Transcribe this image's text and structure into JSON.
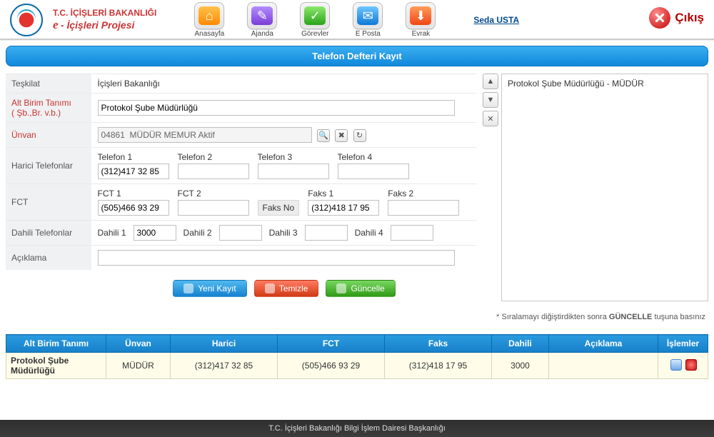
{
  "header": {
    "ministry": "T.C. İÇİŞLERİ BAKANLIĞI",
    "project_prefix": "e",
    "project_rest": " - İçişleri Projesi",
    "nav": [
      {
        "id": "anasayfa",
        "label": "Anasayfa",
        "tint": "orange",
        "glyph": "⌂"
      },
      {
        "id": "ajanda",
        "label": "Ajanda",
        "tint": "purple",
        "glyph": "✎"
      },
      {
        "id": "gorevler",
        "label": "Görevler",
        "tint": "green",
        "glyph": "✓"
      },
      {
        "id": "eposta",
        "label": "E Posta",
        "tint": "blue",
        "glyph": "✉"
      },
      {
        "id": "evrak",
        "label": "Evrak",
        "tint": "red",
        "glyph": "⬇"
      }
    ],
    "user": "Seda USTA",
    "exit": "Çıkış"
  },
  "title": "Telefon Defteri Kayıt",
  "labels": {
    "teskilat": "Teşkilat",
    "alt_birim": "Alt Birim Tanımı\n( Şb.,Br. v.b.)",
    "unvan": "Ünvan",
    "harici": "Harici Telefonlar",
    "fct": "FCT",
    "dahili": "Dahili Telefonlar",
    "aciklama": "Açıklama",
    "telefon1": "Telefon 1",
    "telefon2": "Telefon 2",
    "telefon3": "Telefon 3",
    "telefon4": "Telefon 4",
    "fct1": "FCT 1",
    "fct2": "FCT 2",
    "faksno": "Faks No",
    "faks1": "Faks 1",
    "faks2": "Faks 2",
    "dahili1": "Dahili 1",
    "dahili2": "Dahili 2",
    "dahili3": "Dahili 3",
    "dahili4": "Dahili 4"
  },
  "values": {
    "teskilat": "İçişleri Bakanlığı",
    "alt_birim": "Protokol Şube Müdürlüğü",
    "unvan": "04861  MÜDÜR MEMUR Aktif",
    "telefon1": "(312)417 32 85",
    "telefon2": "",
    "telefon3": "",
    "telefon4": "",
    "fct1": "(505)466 93 29",
    "fct2": "",
    "faks1": "(312)418 17 95",
    "faks2": "",
    "dahili1": "3000",
    "dahili2": "",
    "dahili3": "",
    "dahili4": "",
    "aciklama": ""
  },
  "side": {
    "selected": "Protokol Şube Müdürlüğü - MÜDÜR"
  },
  "actions": {
    "new": "Yeni Kayıt",
    "clear": "Temizle",
    "update": "Güncelle"
  },
  "note_pre": "* Sıralamayı diğiştirdikten sonra ",
  "note_bold": "GÜNCELLE",
  "note_post": " tuşuna basınız",
  "grid": {
    "headers": {
      "alt_birim": "Alt Birim Tanımı",
      "unvan": "Ünvan",
      "harici": "Harici",
      "fct": "FCT",
      "faks": "Faks",
      "dahili": "Dahili",
      "aciklama": "Açıklama",
      "islemler": "İşlemler"
    },
    "row": {
      "alt_birim": "Protokol Şube Müdürlüğü",
      "unvan": "MÜDÜR",
      "harici": "(312)417 32 85",
      "fct": "(505)466 93 29",
      "faks": "(312)418 17 95",
      "dahili": "3000",
      "aciklama": ""
    }
  },
  "footer": "T.C. İçişleri Bakanlığı Bilgi İşlem Dairesi Başkanlığı"
}
